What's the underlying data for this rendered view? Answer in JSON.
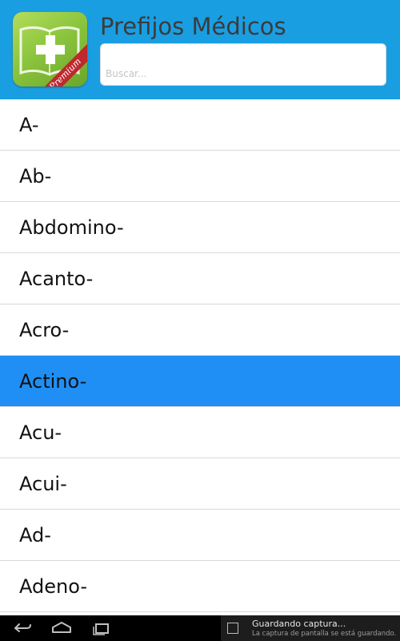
{
  "app": {
    "title": "Prefijos Médicos",
    "logo_badge": "Premium"
  },
  "search": {
    "placeholder": "Buscar..."
  },
  "list": {
    "items": [
      "A-",
      "Ab-",
      "Abdomino-",
      "Acanto-",
      "Acro-",
      "Actino-",
      "Acu-",
      "Acui-",
      "Ad-",
      "Adeno-"
    ],
    "selected_index": 5
  },
  "colors": {
    "header": "#1a9ee2",
    "selected_row": "#1f8ff5",
    "logo": "#8cc63e"
  },
  "system_bar": {
    "buttons": [
      "back-icon",
      "home-icon",
      "recent-apps-icon"
    ],
    "notification": {
      "icon": "image-icon",
      "title": "Guardando captura...",
      "subtitle": "La captura de pantalla se está guardando."
    }
  }
}
